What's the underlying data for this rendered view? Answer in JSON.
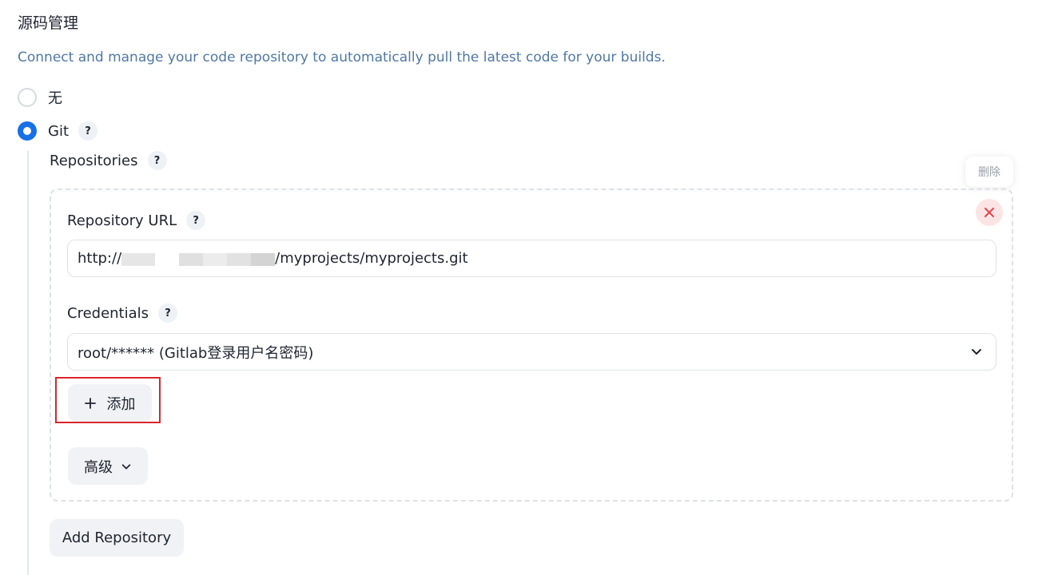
{
  "section": {
    "title": "源码管理",
    "description": "Connect and manage your code repository to automatically pull the latest code for your builds."
  },
  "scm_options": [
    {
      "label": "无",
      "checked": false
    },
    {
      "label": "Git",
      "checked": true
    }
  ],
  "help_glyph": "?",
  "repositories_label": "Repositories",
  "delete_tooltip": "删除",
  "repo": {
    "url_label": "Repository URL",
    "url_prefix": "http://",
    "url_suffix": "/myprojects/myprojects.git",
    "credentials_label": "Credentials",
    "credentials_value": "root/****** (Gitlab登录用户名密码)",
    "add_button": "添加",
    "advanced_button": "高级"
  },
  "add_repository_button": "Add Repository",
  "colors": {
    "accent": "#1770e6",
    "description": "#4f78a6",
    "highlight": "#d9262c",
    "delete_bg": "#fde4e4",
    "delete_fg": "#e0474b"
  },
  "icons": {
    "close": "close-icon",
    "plus": "plus-icon",
    "chevron": "chevron-down-icon"
  }
}
